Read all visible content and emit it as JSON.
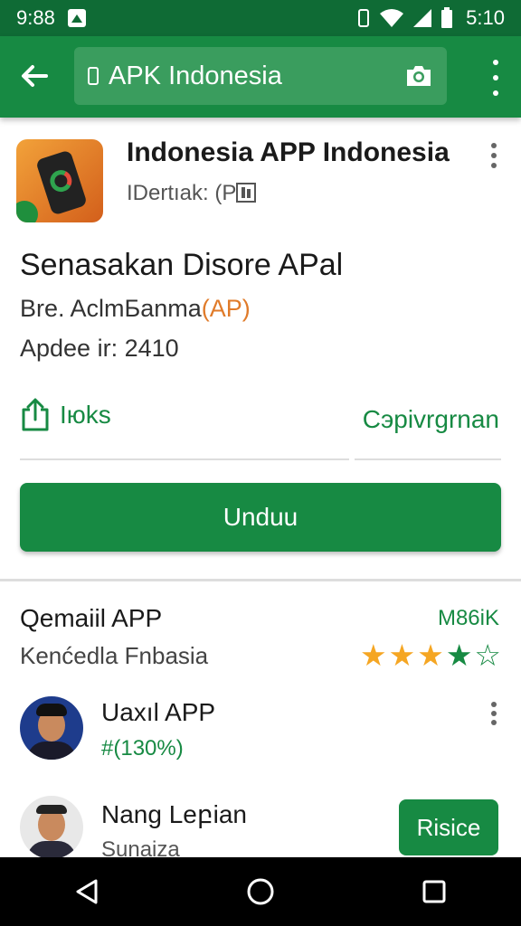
{
  "status_bar": {
    "time_left": "9:88",
    "time_right": "5:10"
  },
  "app_bar": {
    "search_text": "APK Indonesia"
  },
  "app": {
    "title": "Indonesia APP Indonesia",
    "developer": "IDertıak: (P",
    "headline": "Senasakan Disore APal",
    "subline_text": "Bre. AclmБanma",
    "subline_accent": "(AP)",
    "updated": "Apdee ir: 2410",
    "share_label": "Iюks",
    "right_link": "Cэpivrgrnan",
    "install_label": "Unduu"
  },
  "section": {
    "title": "Qemaiil APP",
    "subtitle": "Kenćedla Fnbasia",
    "meta": "M86iK",
    "rating": {
      "value": 4,
      "max": 5
    }
  },
  "users": [
    {
      "name": "Uaxıl APP",
      "meta": "#(130%)"
    },
    {
      "name": "Nang Leբian",
      "sub": "Sunaiza",
      "button_label": "Risiсe"
    }
  ],
  "colors": {
    "primary": "#178a43",
    "status_bar": "#0f6b35",
    "accent": "#e07b2a",
    "star": "#f5a623"
  }
}
